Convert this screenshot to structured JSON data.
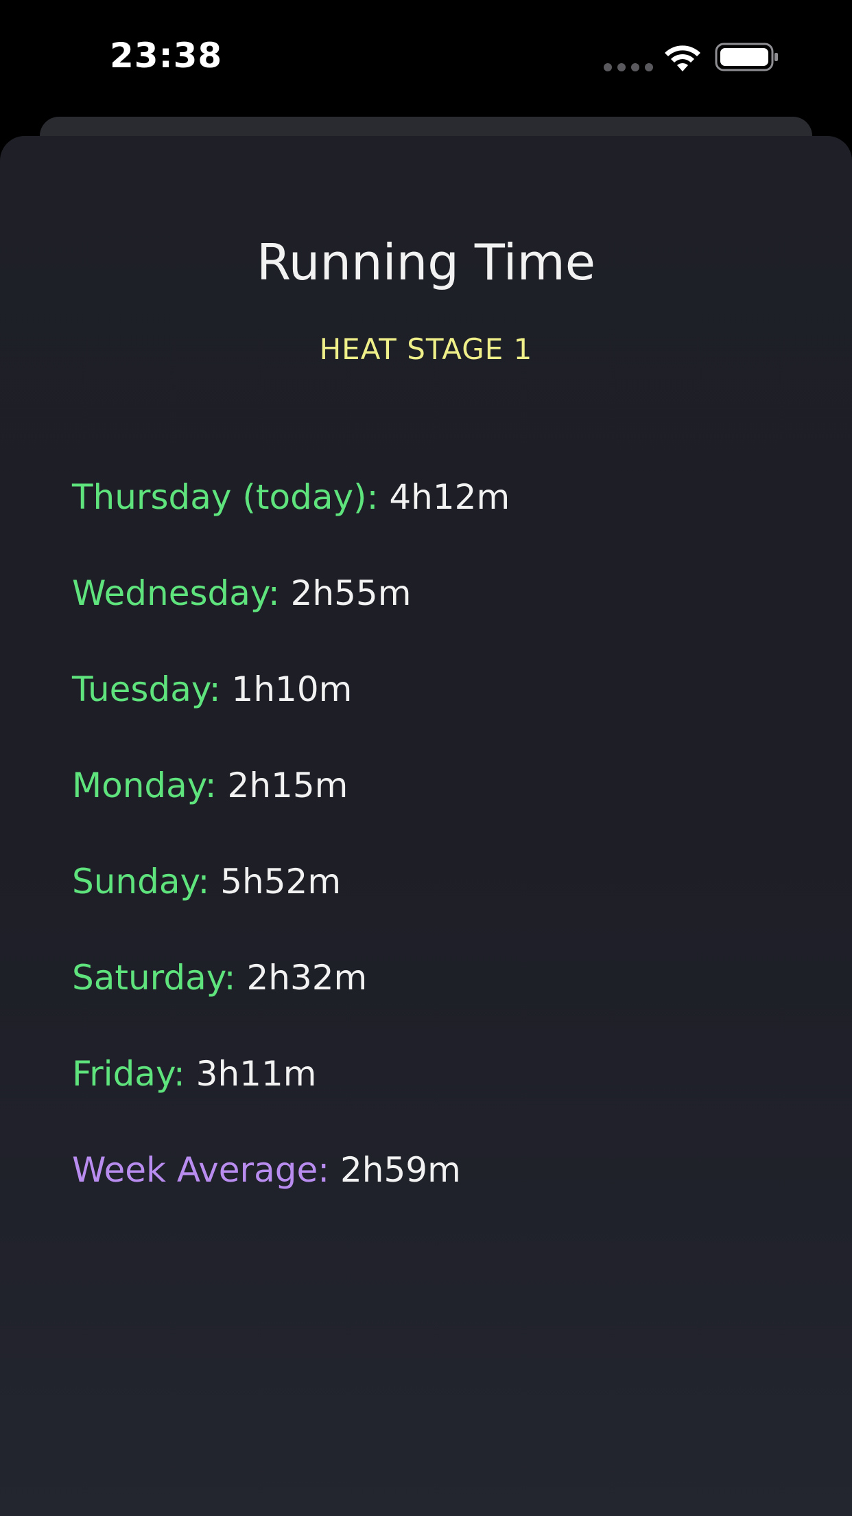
{
  "status_bar": {
    "time": "23:38"
  },
  "header": {
    "title": "Running Time",
    "subtitle": "HEAT STAGE 1"
  },
  "days": [
    {
      "label": "Thursday (today):",
      "value": "4h12m"
    },
    {
      "label": "Wednesday:",
      "value": "2h55m"
    },
    {
      "label": "Tuesday:",
      "value": "1h10m"
    },
    {
      "label": "Monday:",
      "value": "2h15m"
    },
    {
      "label": "Sunday:",
      "value": "5h52m"
    },
    {
      "label": "Saturday:",
      "value": "2h32m"
    },
    {
      "label": "Friday:",
      "value": "3h11m"
    }
  ],
  "average": {
    "label": "Week Average:",
    "value": "2h59m"
  },
  "colors": {
    "day_label": "#5ee37d",
    "average_label": "#b98cf0",
    "subtitle": "#f0f08a",
    "value_text": "#f2f2f2",
    "background": "#1f2027"
  }
}
